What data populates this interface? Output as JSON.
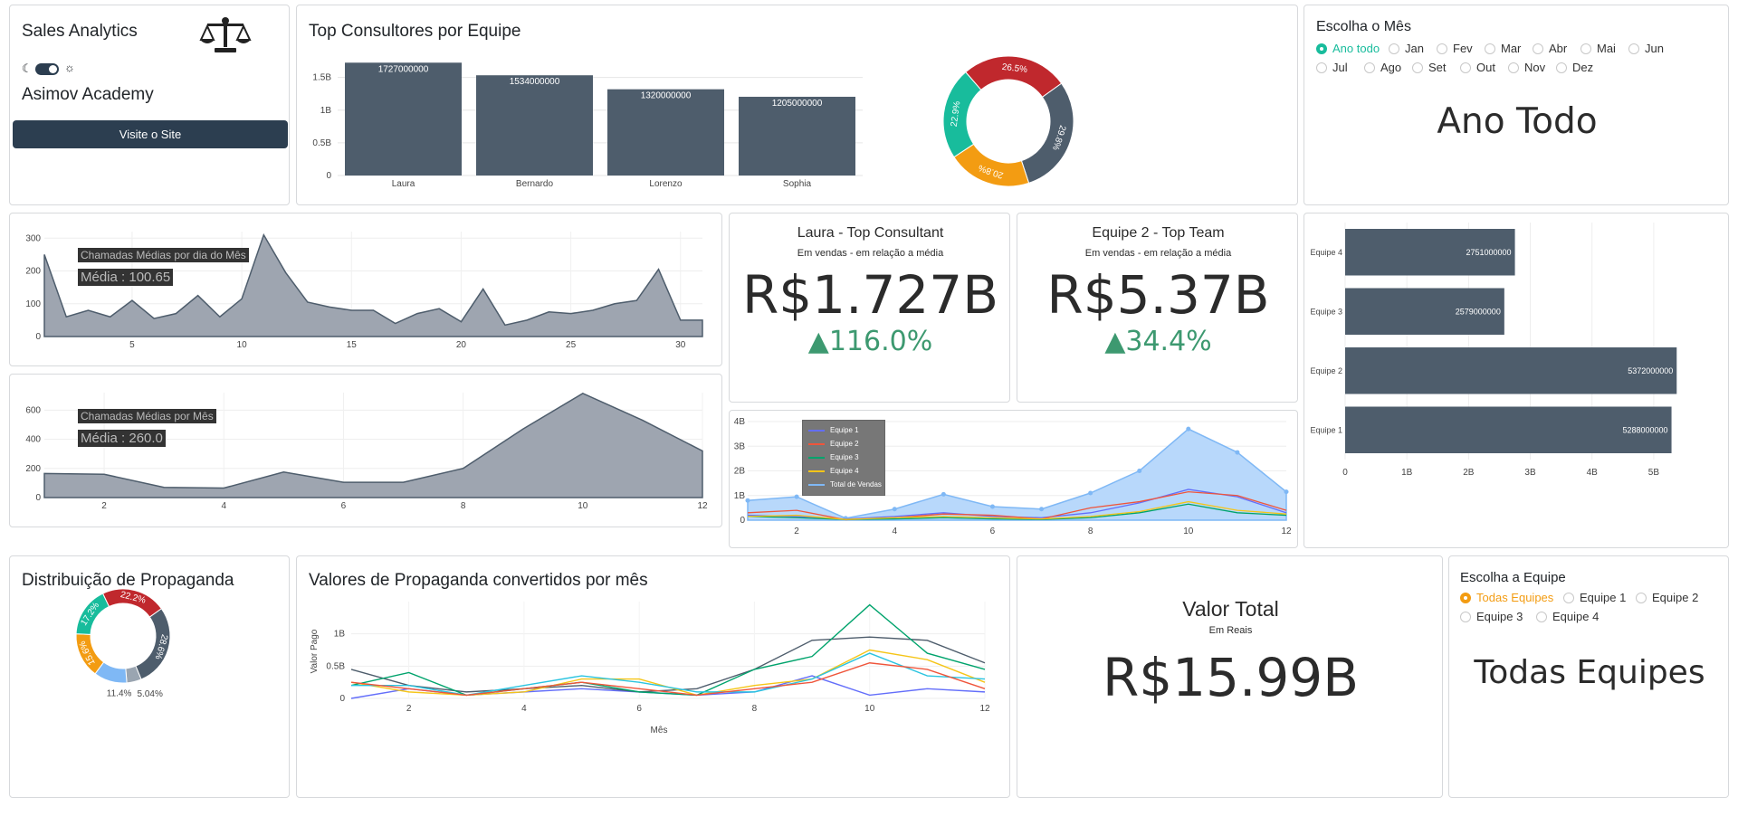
{
  "header": {
    "app_title": "Sales Analytics",
    "scale_icon": "scale-icon",
    "moon_icon": "moon-icon",
    "sun_icon": "sun-icon",
    "org_name": "Asimov Academy",
    "visit_button": "Visite o Site"
  },
  "top_consultants": {
    "title": "Top Consultores por Equipe",
    "yticks": [
      "1.5B",
      "1B",
      "0.5B",
      "0"
    ],
    "bars": [
      {
        "name": "Laura",
        "value": 1727000000,
        "label": "1727000000"
      },
      {
        "name": "Bernardo",
        "value": 1534000000,
        "label": "1534000000"
      },
      {
        "name": "Lorenzo",
        "value": 1320000000,
        "label": "1320000000"
      },
      {
        "name": "Sophia",
        "value": 1205000000,
        "label": "1205000000"
      }
    ],
    "donut": [
      {
        "label": "29.8%",
        "value": 29.8,
        "color": "#4e5d6c"
      },
      {
        "label": "20.8%",
        "value": 20.8,
        "color": "#f39c12"
      },
      {
        "label": "22.9%",
        "value": 22.9,
        "color": "#18bc9c"
      },
      {
        "label": "26.5%",
        "value": 26.5,
        "color": "#c0282d"
      }
    ]
  },
  "month_select": {
    "title": "Escolha o Mês",
    "options": [
      "Ano todo",
      "Jan",
      "Fev",
      "Mar",
      "Abr",
      "Mai",
      "Jun",
      "Jul",
      "Ago",
      "Set",
      "Out",
      "Nov",
      "Dez"
    ],
    "selected": "Ano todo",
    "display": "Ano Todo"
  },
  "calls_day": {
    "annotation": "Chamadas Médias por dia do Mês",
    "mean": "Média : 100.65",
    "yticks": [
      "300",
      "200",
      "100",
      "0"
    ],
    "xticks": [
      "5",
      "10",
      "15",
      "20",
      "25",
      "30"
    ]
  },
  "calls_month": {
    "annotation": "Chamadas Médias por Mês",
    "mean": "Média : 260.0",
    "yticks": [
      "600",
      "400",
      "200",
      "0"
    ],
    "xticks": [
      "2",
      "4",
      "6",
      "8",
      "10",
      "12"
    ]
  },
  "kpi_consultant": {
    "title": "Laura - Top Consultant",
    "subtitle": "Em vendas - em relação a média",
    "value": "R$1.727B",
    "delta": "▲116.0%"
  },
  "kpi_team": {
    "title": "Equipe 2 - Top Team",
    "subtitle": "Em vendas - em relação a média",
    "value": "R$5.37B",
    "delta": "▲34.4%"
  },
  "team_bars": {
    "xticks": [
      "0",
      "1B",
      "2B",
      "3B",
      "4B",
      "5B"
    ],
    "bars": [
      {
        "name": "Equipe 4",
        "value": 2751000000,
        "label": "2751000000"
      },
      {
        "name": "Equipe 3",
        "value": 2579000000,
        "label": "2579000000"
      },
      {
        "name": "Equipe 2",
        "value": 5372000000,
        "label": "5372000000"
      },
      {
        "name": "Equipe 1",
        "value": 5288000000,
        "label": "5288000000"
      }
    ]
  },
  "team_lines": {
    "yticks": [
      "4B",
      "3B",
      "2B",
      "1B",
      "0"
    ],
    "xticks": [
      "2",
      "4",
      "6",
      "8",
      "10",
      "12"
    ],
    "legend": [
      {
        "name": "Equipe 1",
        "color": "#636efa"
      },
      {
        "name": "Equipe 2",
        "color": "#ef553b"
      },
      {
        "name": "Equipe 3",
        "color": "#00a36c"
      },
      {
        "name": "Equipe 4",
        "color": "#f5c518"
      },
      {
        "name": "Total de Vendas",
        "color": "#7fb8f5"
      }
    ]
  },
  "ad_distribution": {
    "title": "Distribuição de Propaganda",
    "slices": [
      {
        "label": "28.6%",
        "value": 28.6,
        "color": "#4e5d6c"
      },
      {
        "label": "5.04%",
        "value": 5.04,
        "color": "#9aa5b1"
      },
      {
        "label": "11.4%",
        "value": 11.4,
        "color": "#7fb8f5"
      },
      {
        "label": "15.6%",
        "value": 15.6,
        "color": "#f39c12"
      },
      {
        "label": "17.2%",
        "value": 17.2,
        "color": "#18bc9c"
      },
      {
        "label": "22.2%",
        "value": 22.2,
        "color": "#c0282d"
      }
    ]
  },
  "ad_values": {
    "title": "Valores de Propaganda convertidos por mês",
    "ylabel": "Valor Pago",
    "xlabel": "Mês",
    "yticks": [
      "1B",
      "0.5B",
      "0"
    ],
    "xticks": [
      "2",
      "4",
      "6",
      "8",
      "10",
      "12"
    ]
  },
  "total": {
    "title": "Valor Total",
    "subtitle": "Em Reais",
    "value": "R$15.99B"
  },
  "team_select": {
    "title": "Escolha a Equipe",
    "options": [
      "Todas Equipes",
      "Equipe 1",
      "Equipe 2",
      "Equipe 3",
      "Equipe 4"
    ],
    "selected": "Todas Equipes",
    "display": "Todas Equipes"
  },
  "chart_data": [
    {
      "type": "bar",
      "title": "Top Consultores por Equipe",
      "categories": [
        "Laura",
        "Bernardo",
        "Lorenzo",
        "Sophia"
      ],
      "values": [
        1727000000,
        1534000000,
        1320000000,
        1205000000
      ],
      "ylim": [
        0,
        1800000000
      ]
    },
    {
      "type": "pie",
      "categories": [
        "29.8%",
        "20.8%",
        "22.9%",
        "26.5%"
      ],
      "values": [
        29.8,
        20.8,
        22.9,
        26.5
      ]
    },
    {
      "type": "area",
      "title": "",
      "x": [
        1,
        2,
        3,
        4,
        5,
        6,
        7,
        8,
        9,
        10,
        11,
        12,
        13,
        14,
        15,
        16,
        17,
        18,
        19,
        20,
        21,
        22,
        23,
        24,
        25,
        26,
        27,
        28,
        29,
        30,
        31
      ],
      "values": [
        250,
        60,
        80,
        60,
        110,
        55,
        70,
        125,
        60,
        115,
        310,
        195,
        105,
        90,
        80,
        80,
        40,
        70,
        85,
        45,
        145,
        35,
        50,
        75,
        70,
        80,
        100,
        110,
        205,
        50,
        50
      ],
      "annotations": [
        "Chamadas Médias por dia do Mês",
        "Média : 100.65"
      ],
      "ylim": [
        0,
        320
      ]
    },
    {
      "type": "area",
      "x": [
        1,
        2,
        3,
        4,
        5,
        6,
        7,
        8,
        9,
        10,
        11,
        12
      ],
      "values": [
        165,
        160,
        70,
        65,
        175,
        105,
        105,
        200,
        470,
        715,
        530,
        320
      ],
      "annotations": [
        "Chamadas Médias por Mês",
        "Média : 260.0"
      ],
      "ylim": [
        0,
        720
      ]
    },
    {
      "type": "bar",
      "orientation": "horizontal",
      "categories": [
        "Equipe 4",
        "Equipe 3",
        "Equipe 2",
        "Equipe 1"
      ],
      "values": [
        2751000000,
        2579000000,
        5372000000,
        5288000000
      ]
    },
    {
      "type": "line",
      "x": [
        1,
        2,
        3,
        4,
        5,
        6,
        7,
        8,
        9,
        10,
        11,
        12
      ],
      "series": [
        {
          "name": "Equipe 1",
          "values": [
            200000000,
            150000000,
            50000000,
            150000000,
            300000000,
            150000000,
            100000000,
            300000000,
            700000000,
            1250000000,
            950000000,
            300000000
          ]
        },
        {
          "name": "Equipe 2",
          "values": [
            300000000,
            400000000,
            20000000,
            100000000,
            250000000,
            200000000,
            50000000,
            500000000,
            750000000,
            1150000000,
            1000000000,
            400000000
          ]
        },
        {
          "name": "Equipe 3",
          "values": [
            150000000,
            100000000,
            30000000,
            50000000,
            100000000,
            50000000,
            30000000,
            100000000,
            300000000,
            650000000,
            300000000,
            200000000
          ]
        },
        {
          "name": "Equipe 4",
          "values": [
            150000000,
            200000000,
            30000000,
            100000000,
            150000000,
            100000000,
            50000000,
            150000000,
            350000000,
            750000000,
            400000000,
            250000000
          ]
        },
        {
          "name": "Total de Vendas",
          "values": [
            800000000,
            950000000,
            80000000,
            450000000,
            1050000000,
            550000000,
            450000000,
            1100000000,
            2000000000,
            3700000000,
            2750000000,
            1150000000
          ]
        }
      ],
      "ylim": [
        0,
        4200000000
      ]
    },
    {
      "type": "pie",
      "title": "Distribuição de Propaganda",
      "categories": [
        "28.6%",
        "5.04%",
        "11.4%",
        "15.6%",
        "17.2%",
        "22.2%"
      ],
      "values": [
        28.6,
        5.04,
        11.4,
        15.6,
        17.2,
        22.2
      ]
    },
    {
      "type": "line",
      "title": "Valores de Propaganda convertidos por mês",
      "xlabel": "Mês",
      "ylabel": "Valor Pago",
      "x": [
        1,
        2,
        3,
        4,
        5,
        6,
        7,
        8,
        9,
        10,
        11,
        12
      ],
      "series": [
        {
          "values": [
            0,
            150000000,
            50000000,
            100000000,
            150000000,
            100000000,
            50000000,
            100000000,
            350000000,
            50000000,
            150000000,
            100000000
          ],
          "color": "#636efa"
        },
        {
          "values": [
            450000000,
            200000000,
            100000000,
            150000000,
            200000000,
            100000000,
            150000000,
            450000000,
            900000000,
            950000000,
            900000000,
            550000000
          ],
          "color": "#4e5d6c"
        },
        {
          "values": [
            250000000,
            100000000,
            50000000,
            100000000,
            300000000,
            300000000,
            50000000,
            200000000,
            300000000,
            750000000,
            600000000,
            250000000
          ],
          "color": "#f5c518"
        },
        {
          "values": [
            200000000,
            400000000,
            50000000,
            150000000,
            250000000,
            100000000,
            50000000,
            450000000,
            650000000,
            1450000000,
            700000000,
            450000000
          ],
          "color": "#00a36c"
        },
        {
          "values": [
            200000000,
            200000000,
            50000000,
            200000000,
            350000000,
            250000000,
            100000000,
            100000000,
            300000000,
            700000000,
            350000000,
            300000000
          ],
          "color": "#2bc4e0"
        },
        {
          "values": [
            250000000,
            150000000,
            50000000,
            150000000,
            250000000,
            150000000,
            50000000,
            150000000,
            250000000,
            550000000,
            450000000,
            150000000
          ],
          "color": "#ef553b"
        }
      ],
      "ylim": [
        0,
        1500000000
      ]
    }
  ]
}
